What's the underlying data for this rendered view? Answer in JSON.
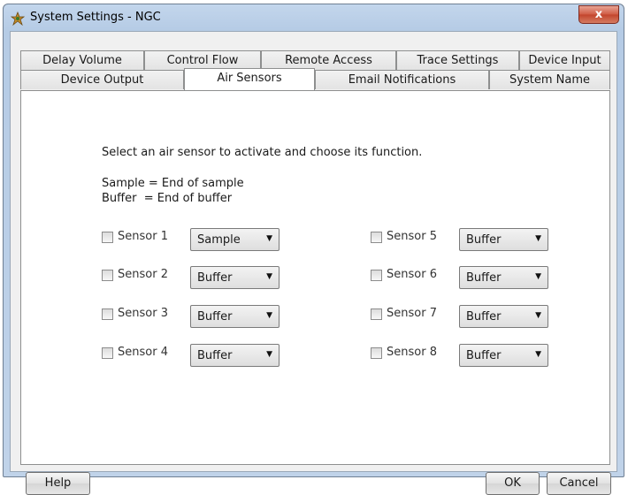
{
  "window": {
    "title": "System Settings - NGC",
    "close_label": "x"
  },
  "tabs_row1": [
    {
      "label": "Delay Volume"
    },
    {
      "label": "Control Flow"
    },
    {
      "label": "Remote Access"
    },
    {
      "label": "Trace Settings"
    },
    {
      "label": "Device Input"
    }
  ],
  "tabs_row2": [
    {
      "label": "Device Output"
    },
    {
      "label": "Air Sensors",
      "active": true
    },
    {
      "label": "Email Notifications"
    },
    {
      "label": "System Name"
    }
  ],
  "panel": {
    "instruction": "Select an air sensor to activate and choose its function.",
    "legend_sample": "Sample = End of sample",
    "legend_buffer": "Buffer  = End of buffer"
  },
  "sensors": [
    {
      "label": "Sensor 1",
      "checked": false,
      "function": "Sample"
    },
    {
      "label": "Sensor 2",
      "checked": false,
      "function": "Buffer"
    },
    {
      "label": "Sensor 3",
      "checked": false,
      "function": "Buffer"
    },
    {
      "label": "Sensor 4",
      "checked": false,
      "function": "Buffer"
    },
    {
      "label": "Sensor 5",
      "checked": false,
      "function": "Buffer"
    },
    {
      "label": "Sensor 6",
      "checked": false,
      "function": "Buffer"
    },
    {
      "label": "Sensor 7",
      "checked": false,
      "function": "Buffer"
    },
    {
      "label": "Sensor 8",
      "checked": false,
      "function": "Buffer"
    }
  ],
  "select_options": [
    "Sample",
    "Buffer"
  ],
  "buttons": {
    "help": "Help",
    "ok": "OK",
    "cancel": "Cancel"
  },
  "icons": {
    "dropdown": "chevron-down-icon",
    "app": "app-icon",
    "close": "close-icon"
  }
}
